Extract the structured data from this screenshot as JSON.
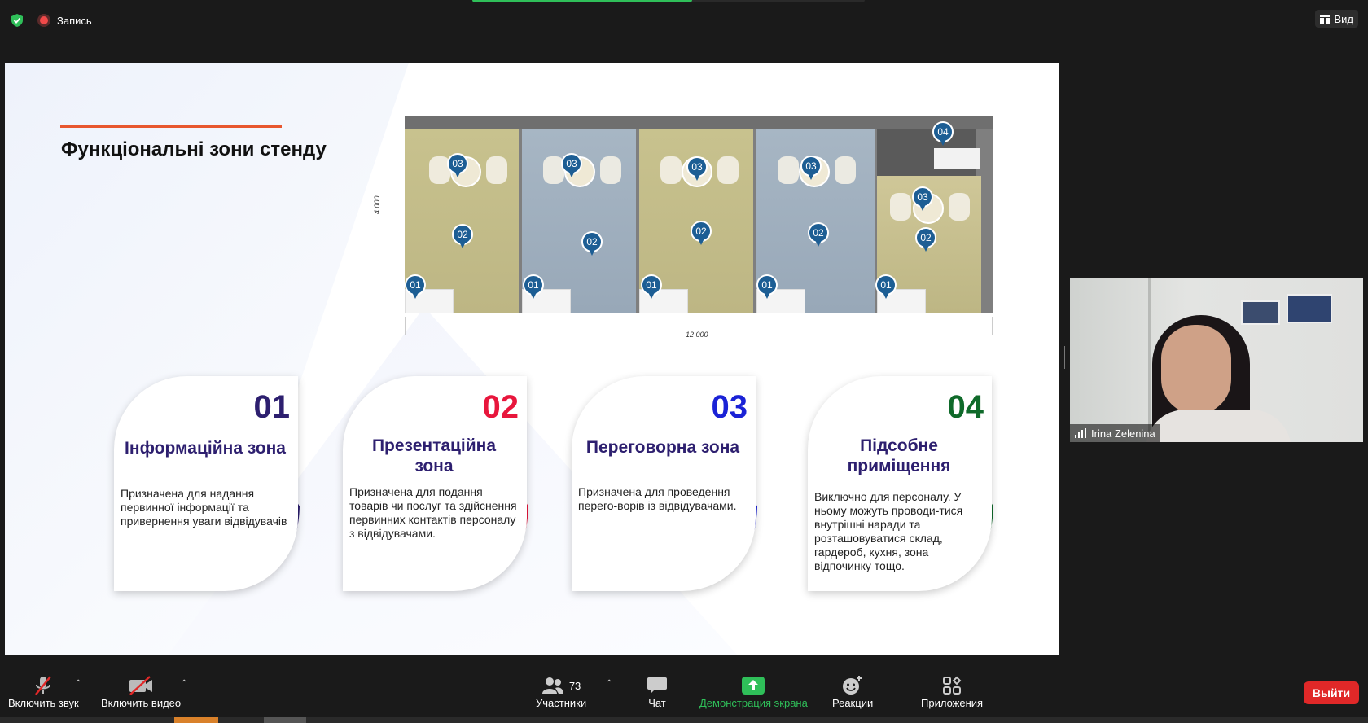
{
  "topbar": {
    "recording_label": "Запись",
    "view_label": "Вид",
    "share_progress": 0.56
  },
  "slide": {
    "title": "Функціональні зони стенду",
    "plan": {
      "dim_width": "12 000",
      "dim_height": "4 000",
      "pins": {
        "p01": "01",
        "p02": "02",
        "p03": "03",
        "p04": "04"
      }
    },
    "cards": [
      {
        "num": "01",
        "name": "Інформаційна зона",
        "desc": "Призначена для надання первинної інформації та привернення уваги відвідувачів",
        "color": "#2d1f6f"
      },
      {
        "num": "02",
        "name": "Презентаційна зона",
        "desc": "Призначена для подання товарів чи послуг та здійснення первинних контактів персоналу з відвідувачами.",
        "color": "#e8163c"
      },
      {
        "num": "03",
        "name": "Переговорна зона",
        "desc": "Призначена для проведення перего-ворів із відвідувачами.",
        "color": "#1a22d6"
      },
      {
        "num": "04",
        "name": "Підсобне приміщення",
        "desc": "Виключно для персоналу. У ньому можуть проводи-тися внутрішні наради та розташовуватися склад, гардероб, кухня, зона відпочинку тощо.",
        "color": "#0f6a2a"
      }
    ]
  },
  "participant": {
    "name": "Irina Zelenina"
  },
  "toolbar": {
    "audio_label": "Включить звук",
    "video_label": "Включить видео",
    "participants_label": "Участники",
    "participants_count": "73",
    "chat_label": "Чат",
    "share_label": "Демонстрация экрана",
    "reactions_label": "Реакции",
    "apps_label": "Приложения",
    "leave_label": "Выйти"
  },
  "colors": {
    "share_green": "#2fbf59",
    "leave_red": "#e02828",
    "title_line": "#e8572f"
  }
}
